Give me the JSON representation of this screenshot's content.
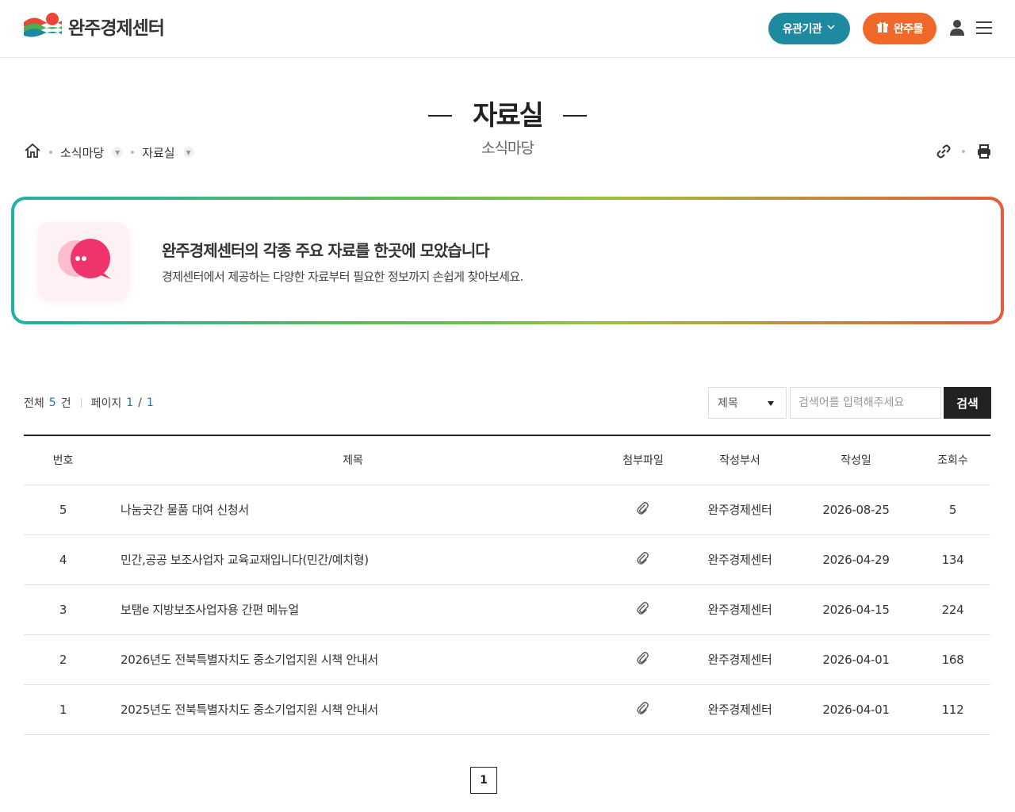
{
  "header": {
    "logo_text": "완주경제센터",
    "related_label": "유관기관",
    "mall_label": "완주몰",
    "brand_teal": "#1e8aa0",
    "brand_orange": "#f0692a"
  },
  "page": {
    "title": "자료실",
    "subtitle": "소식마당"
  },
  "breadcrumb": {
    "items": [
      "소식마당",
      "자료실"
    ]
  },
  "banner": {
    "title": "완주경제센터의 각종 주요 자료를 한곳에 모았습니다",
    "description": "경제센터에서 제공하는 다양한 자료부터 필요한 정보까지 손쉽게 찾아보세요."
  },
  "list_info": {
    "total_label": "전체",
    "total_count": "5",
    "count_unit": "건",
    "page_label": "페이지",
    "current_page": "1",
    "slash": "/",
    "total_pages": "1"
  },
  "search": {
    "select_value": "제목",
    "placeholder": "검색어를 입력해주세요",
    "button_label": "검색"
  },
  "table": {
    "headers": [
      "번호",
      "제목",
      "첨부파일",
      "작성부서",
      "작성일",
      "조회수"
    ],
    "rows": [
      {
        "no": "5",
        "subject": "나눔곳간 물품 대여 신청서",
        "dept": "완주경제센터",
        "date": "2026-08-25",
        "views": "5"
      },
      {
        "no": "4",
        "subject": "민간,공공 보조사업자 교육교재입니다(민간/예치형)",
        "dept": "완주경제센터",
        "date": "2026-04-29",
        "views": "134"
      },
      {
        "no": "3",
        "subject": "보탬e 지방보조사업자용 간편 메뉴얼",
        "dept": "완주경제센터",
        "date": "2026-04-15",
        "views": "224"
      },
      {
        "no": "2",
        "subject": "2026년도 전북특별자치도 중소기업지원 시책 안내서",
        "dept": "완주경제센터",
        "date": "2026-04-01",
        "views": "168"
      },
      {
        "no": "1",
        "subject": "2025년도 전북특별자치도 중소기업지원 시책 안내서",
        "dept": "완주경제센터",
        "date": "2026-04-01",
        "views": "112"
      }
    ]
  },
  "pagination": {
    "current": "1"
  }
}
